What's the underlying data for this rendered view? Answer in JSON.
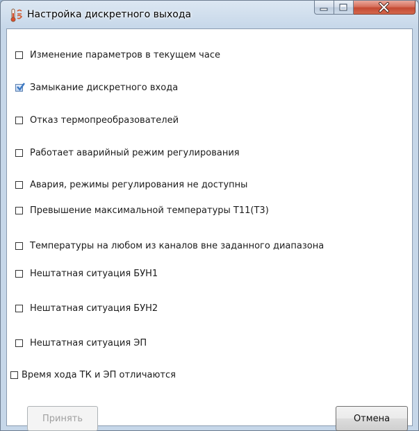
{
  "window": {
    "title": "Настройка дискретного выхода"
  },
  "options": [
    {
      "label": "Изменение параметров в текущем часе",
      "checked": false
    },
    {
      "label": "Замыкание дискретного входа",
      "checked": true
    },
    {
      "label": "Отказ термопреобразователей",
      "checked": false
    },
    {
      "label": "Работает аварийный режим регулирования",
      "checked": false
    },
    {
      "label": "Авария, режимы регулирования не доступны",
      "checked": false
    },
    {
      "label": "Превышение максимальной температуры Т11(Т3)",
      "checked": false
    },
    {
      "label": "Температуры на любом из каналов вне заданного диапазона",
      "checked": false
    },
    {
      "label": "Нештатная ситуация БУН1",
      "checked": false
    },
    {
      "label": "Нештатная ситуация БУН2",
      "checked": false
    },
    {
      "label": "Нештатная ситуация ЭП",
      "checked": false
    },
    {
      "label": "Время хода ТК и ЭП отличаются",
      "checked": false
    }
  ],
  "buttons": {
    "accept_label": "Принять",
    "accept_enabled": false,
    "cancel_label": "Отмена"
  },
  "colors": {
    "accent": "#3b78c2",
    "close": "#c44a33"
  }
}
